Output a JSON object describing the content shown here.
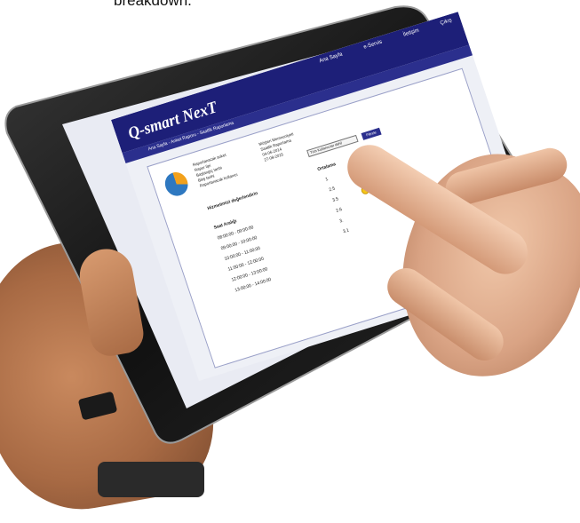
{
  "caption": "breakdown.",
  "app": {
    "logo": "Q-smart NexT",
    "nav": [
      "Ana Sayfa",
      "e-Servis",
      "İletişim",
      "Çıkış"
    ],
    "breadcrumb": "Ana Sayfa - Anket Raporu - Saatlik Raporlama"
  },
  "report": {
    "info_rows": [
      {
        "key": "Raporlanacak anket",
        "value": "Müşteri Memnuniyeti"
      },
      {
        "key": "Rapor tipi",
        "value": "Saatlik Raporlama"
      },
      {
        "key": "Başlangıç tarihi",
        "value": "04-06-2014"
      },
      {
        "key": "Bitiş tarihi",
        "value": "27-08-2015"
      },
      {
        "key": "Raporlanacak kullanıcı",
        "value": ""
      }
    ],
    "user_select": "Tüm Kullanıcılar dahil",
    "filter_button": "Filtrele",
    "table_title": "Hizmetimizi değerlendirin",
    "column_header": "Ortalama",
    "first_value": "1",
    "section": "Saat Aralığı",
    "rows": [
      {
        "range": "08:00:00 - 09:00:00",
        "value": "2.5"
      },
      {
        "range": "09:00:00 - 10:00:00",
        "value": "3.5"
      },
      {
        "range": "10:00:00 - 11:00:00",
        "value": "2.6"
      },
      {
        "range": "11:00:00 - 12:00:00",
        "value": "3."
      },
      {
        "range": "12:00:00 - 13:00:00",
        "value": "3.1"
      },
      {
        "range": "13:00:00 - 14:00:00",
        "value": ""
      }
    ]
  },
  "colors": {
    "header": "#1d1f78",
    "accent": "#2b2f8d",
    "smiley": "#f5c518",
    "pie_orange": "#f2a11c",
    "pie_blue": "#2e78c0"
  }
}
